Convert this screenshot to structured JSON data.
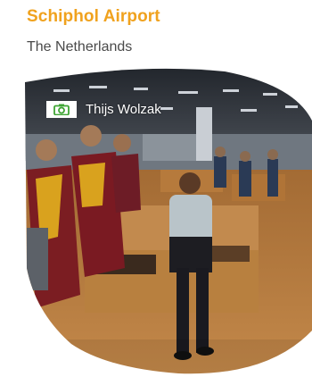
{
  "header": {
    "title": "Schiphol Airport",
    "subtitle": "The Netherlands"
  },
  "photo": {
    "credit_icon": "camera-icon",
    "credit": "Thijs Wolzak"
  },
  "colors": {
    "title": "#f0a21e",
    "subtitle": "#4a4a4a",
    "camera_green": "#3fa535"
  }
}
